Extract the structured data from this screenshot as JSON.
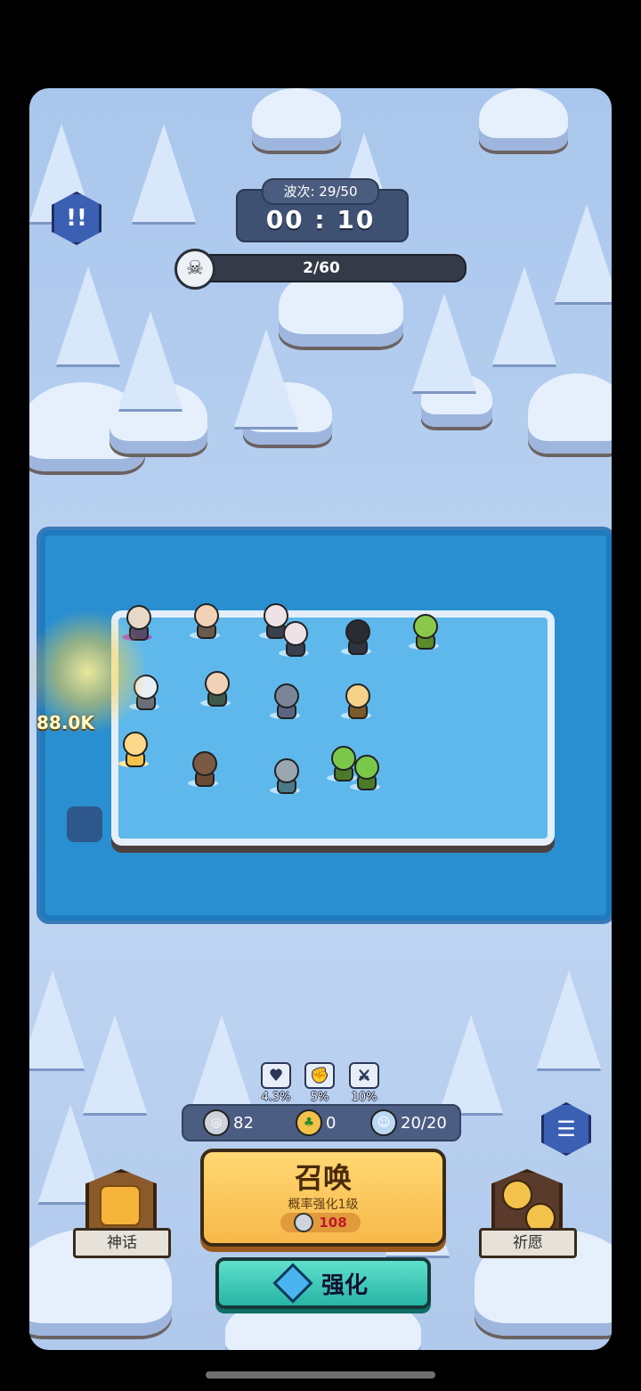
{
  "hud": {
    "wave_label": "波次: 29/50",
    "timer": "00 : 10",
    "enemy_count": "2/60",
    "pause_icon": "pause-alert-icon",
    "skull_icon": "skull-icon"
  },
  "battle": {
    "damage_text": "88.0K"
  },
  "boosts": [
    {
      "icon": "heart-up-icon",
      "value": "4.3%"
    },
    {
      "icon": "fist-up-icon",
      "value": "5%"
    },
    {
      "icon": "sword-up-icon",
      "value": "10%"
    }
  ],
  "resources": {
    "silver": "82",
    "clover": "0",
    "units": "20/20"
  },
  "summon": {
    "title": "召唤",
    "subtitle": "概率强化1级",
    "cost": "108"
  },
  "upgrade": {
    "label": "强化"
  },
  "myth": {
    "label": "神话"
  },
  "wish": {
    "label": "祈愿"
  },
  "colors": {
    "lake": "#2a8fd0",
    "ice": "#5fb8ec",
    "summon_gold": "#f8b84a",
    "upgrade_teal": "#27b5a4",
    "cost_red": "#c0182a"
  }
}
